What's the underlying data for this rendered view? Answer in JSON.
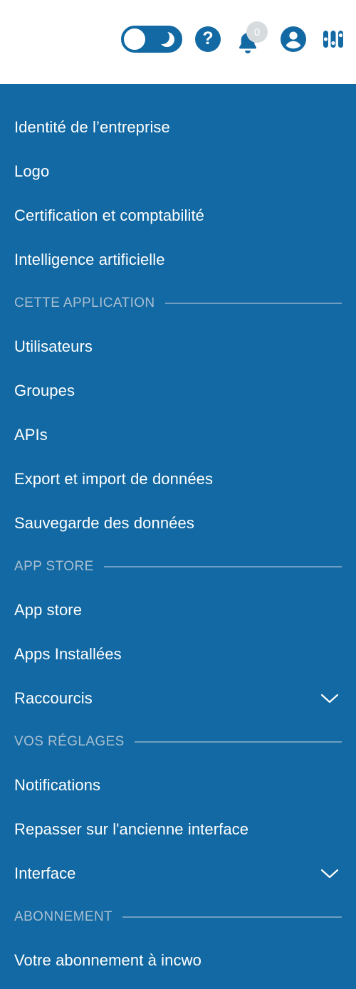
{
  "topbar": {
    "icons": [
      {
        "name": "dark-mode-toggle",
        "state": "off",
        "track_color": "#1269a3"
      },
      {
        "name": "help-icon",
        "glyph": "?"
      },
      {
        "name": "notifications-bell-icon",
        "badge_count": "0"
      },
      {
        "name": "user-account-icon"
      },
      {
        "name": "settings-sliders-icon"
      }
    ],
    "notification_badge": "0",
    "help_glyph": "?"
  },
  "sidebar": {
    "background_color": "#1269a3",
    "text_color": "#ffffff",
    "section_label_color": "#a8bfd2",
    "groups": [
      {
        "section": null,
        "items": [
          {
            "label": "Identité de l’entreprise",
            "expandable": false
          },
          {
            "label": "Logo",
            "expandable": false
          },
          {
            "label": "Certification et comptabilité",
            "expandable": false
          },
          {
            "label": "Intelligence artificielle",
            "expandable": false
          }
        ]
      },
      {
        "section": "CETTE APPLICATION",
        "items": [
          {
            "label": "Utilisateurs",
            "expandable": false
          },
          {
            "label": "Groupes",
            "expandable": false
          },
          {
            "label": "APIs",
            "expandable": false
          },
          {
            "label": "Export et import de données",
            "expandable": false
          },
          {
            "label": "Sauvegarde des données",
            "expandable": false
          }
        ]
      },
      {
        "section": "APP STORE",
        "items": [
          {
            "label": "App store",
            "expandable": false
          },
          {
            "label": "Apps Installées",
            "expandable": false
          },
          {
            "label": "Raccourcis",
            "expandable": true
          }
        ]
      },
      {
        "section": "VOS RÉGLAGES",
        "items": [
          {
            "label": "Notifications",
            "expandable": false
          },
          {
            "label": "Repasser sur l'ancienne interface",
            "expandable": false
          },
          {
            "label": "Interface",
            "expandable": true
          }
        ]
      },
      {
        "section": "ABONNEMENT",
        "items": [
          {
            "label": "Votre abonnement à incwo",
            "expandable": false
          }
        ]
      }
    ]
  }
}
